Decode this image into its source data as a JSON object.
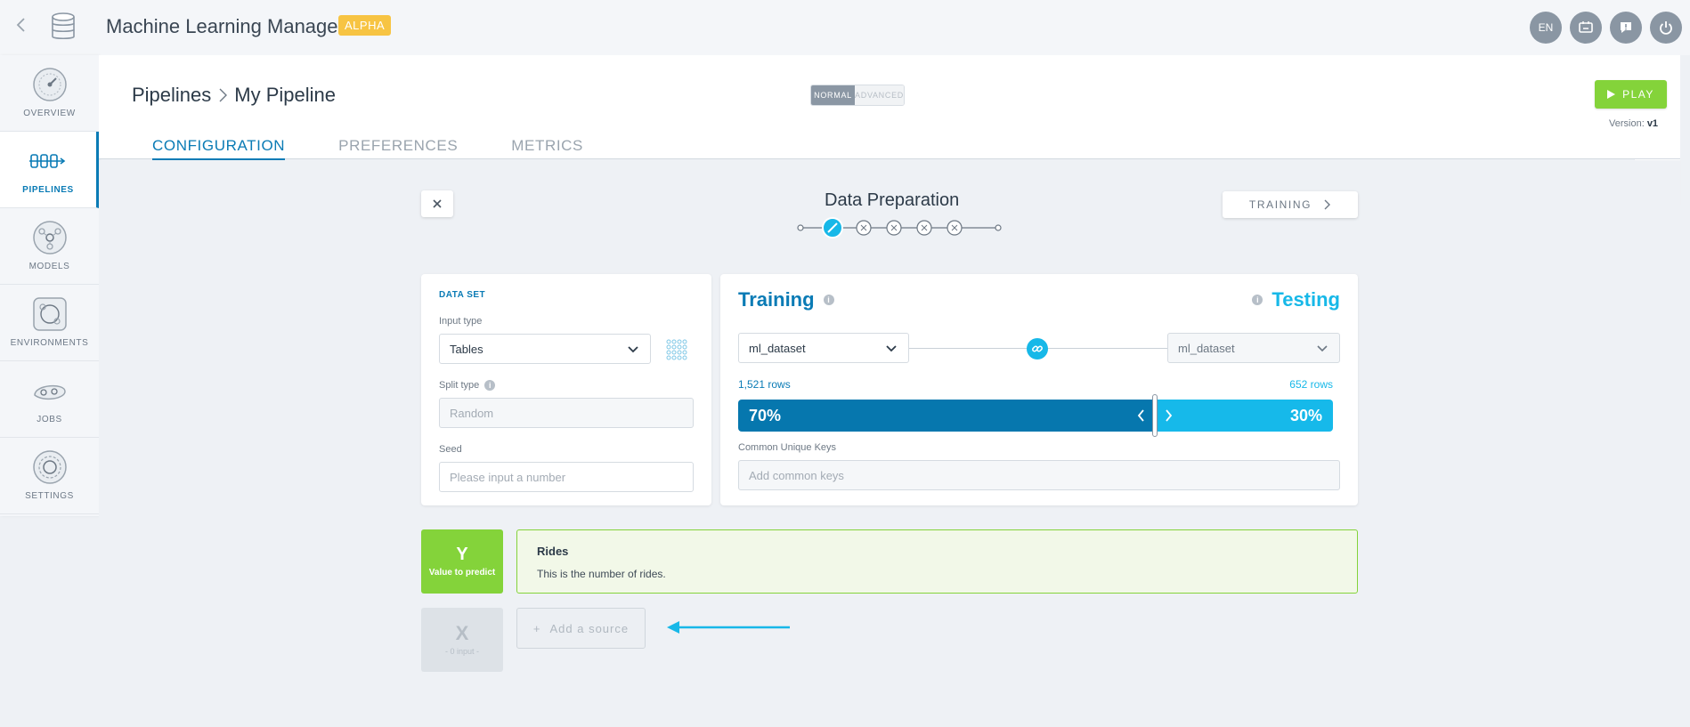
{
  "app": {
    "title": "Machine Learning Manager",
    "badge": "ALPHA"
  },
  "topbar": {
    "language": "EN",
    "icons": [
      "monitor-icon",
      "feedback-icon",
      "power-icon"
    ]
  },
  "sidebar": {
    "items": [
      {
        "label": "OVERVIEW",
        "icon": "gauge-icon",
        "active": false
      },
      {
        "label": "PIPELINES",
        "icon": "pipeline-icon",
        "active": true
      },
      {
        "label": "MODELS",
        "icon": "model-icon",
        "active": false
      },
      {
        "label": "ENVIRONMENTS",
        "icon": "environment-icon",
        "active": false
      },
      {
        "label": "JOBS",
        "icon": "jobs-icon",
        "active": false
      },
      {
        "label": "SETTINGS",
        "icon": "settings-icon",
        "active": false
      }
    ]
  },
  "header": {
    "breadcrumb_root": "Pipelines",
    "breadcrumb_current": "My Pipeline",
    "mode_normal": "NORMAL",
    "mode_advanced": "ADVANCED",
    "play_label": "PLAY",
    "version_label": "Version:",
    "version_value": "v1",
    "tabs": [
      "CONFIGURATION",
      "PREFERENCES",
      "METRICS"
    ]
  },
  "wizard": {
    "step_title": "Data Preparation",
    "next_label": "TRAINING",
    "steps_total": 5,
    "current_step": 1
  },
  "dataset": {
    "title": "DATA SET",
    "input_type_label": "Input type",
    "input_type_value": "Tables",
    "split_type_label": "Split type",
    "split_type_value": "Random",
    "seed_label": "Seed",
    "seed_placeholder": "Please input a number"
  },
  "split": {
    "training_title": "Training",
    "testing_title": "Testing",
    "training_dataset": "ml_dataset",
    "testing_dataset": "ml_dataset",
    "training_rows": "1,521 rows",
    "testing_rows": "652 rows",
    "training_pct_label": "70%",
    "testing_pct_label": "30%",
    "training_fraction": 0.7,
    "keys_label": "Common Unique Keys",
    "keys_placeholder": "Add common keys"
  },
  "target": {
    "letter": "Y",
    "subtitle": "Value to predict",
    "name": "Rides",
    "description": "This is the number of rides."
  },
  "inputs": {
    "letter": "X",
    "subtitle": "- 0 input -",
    "add_source_label": "Add a source"
  },
  "colors": {
    "primary": "#0a7bb5",
    "secondary": "#17b8e8",
    "success": "#84d33a",
    "badge": "#f7c443"
  }
}
